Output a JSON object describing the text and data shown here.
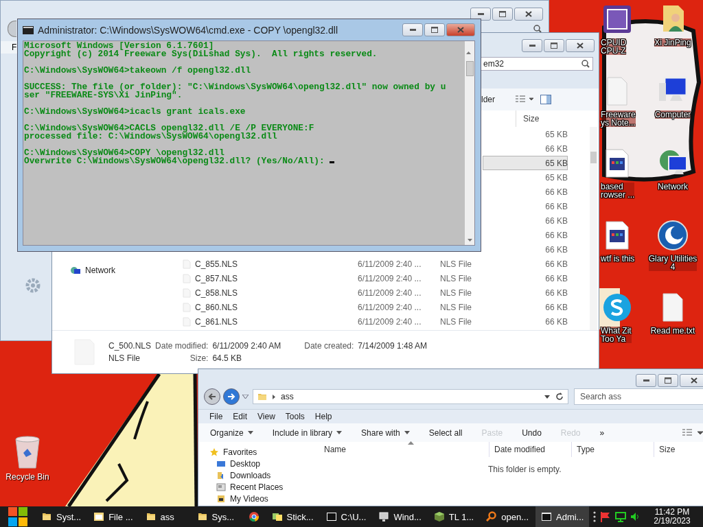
{
  "back_window": {
    "menu": [
      "F"
    ]
  },
  "system32_window": {
    "search_value": "em32",
    "toolbar": [
      "lder"
    ],
    "columns": [
      {
        "label": "Size"
      }
    ],
    "rows": [
      {
        "size": "65 KB",
        "selected": false
      },
      {
        "size": "66 KB",
        "selected": false
      },
      {
        "size": "65 KB",
        "selected": true
      },
      {
        "size": "65 KB",
        "selected": false
      },
      {
        "size": "66 KB",
        "selected": false
      },
      {
        "size": "66 KB",
        "selected": false
      },
      {
        "size": "66 KB",
        "selected": false
      },
      {
        "size": "66 KB",
        "selected": false
      },
      {
        "size": "66 KB",
        "selected": false
      },
      {
        "name": "C_855.NLS",
        "date": "6/11/2009 2:40 ...",
        "type": "NLS File",
        "size": "66 KB",
        "selected": false
      },
      {
        "name": "C_857.NLS",
        "date": "6/11/2009 2:40 ...",
        "type": "NLS File",
        "size": "66 KB",
        "selected": false
      },
      {
        "name": "C_858.NLS",
        "date": "6/11/2009 2:40 ...",
        "type": "NLS File",
        "size": "66 KB",
        "selected": false
      },
      {
        "name": "C_860.NLS",
        "date": "6/11/2009 2:40 ...",
        "type": "NLS File",
        "size": "66 KB",
        "selected": false
      },
      {
        "name": "C_861.NLS",
        "date": "6/11/2009 2:40 ...",
        "type": "NLS File",
        "size": "66 KB",
        "selected": false
      }
    ],
    "nav": [
      {
        "label": "Network"
      }
    ],
    "details": {
      "name": "C_500.NLS",
      "type": "NLS File",
      "date_modified_label": "Date modified:",
      "date_modified": "6/11/2009 2:40 AM",
      "date_created_label": "Date created:",
      "date_created": "7/14/2009 1:48 AM",
      "size_label": "Size:",
      "size": "64.5 KB"
    }
  },
  "cmd_window": {
    "title": "Administrator: C:\\Windows\\SysWOW64\\cmd.exe - COPY  \\opengl32.dll",
    "blocks": [
      [
        "Microsoft Windows [Version 6.1.7601]",
        "Copyright (c) 2014 Freeware Sys(DiLshad Sys).  All rights reserved."
      ],
      [
        "C:\\Windows\\SysWOW64>takeown /f opengl32.dll"
      ],
      [
        "SUCCESS: The file (or folder): \"C:\\Windows\\SysWOW64\\opengl32.dll\" now owned by u",
        "ser \"FREEWARE-SYS\\Xi JinPing\"."
      ],
      [
        "C:\\Windows\\SysWOW64>icacls grant icals.exe"
      ],
      [
        "C:\\Windows\\SysWOW64>CACLS opengl32.dll /E /P EVERYONE:F",
        "processed file: C:\\Windows\\SysWOW64\\opengl32.dll"
      ],
      [
        "C:\\Windows\\SysWOW64>COPY \\opengl32.dll",
        "Overwrite C:\\Windows\\SysWOW64\\opengl32.dll? (Yes/No/All): "
      ]
    ]
  },
  "ass_window": {
    "address": "ass",
    "search_placeholder": "Search ass",
    "menu": [
      "File",
      "Edit",
      "View",
      "Tools",
      "Help"
    ],
    "toolbar": [
      {
        "label": "Organize",
        "kind": "menu",
        "disabled": false
      },
      {
        "label": "Include in library",
        "kind": "menu",
        "disabled": false
      },
      {
        "label": "Share with",
        "kind": "menu",
        "disabled": false
      },
      {
        "label": "Select all",
        "kind": "command",
        "disabled": false
      },
      {
        "label": "Paste",
        "kind": "command",
        "disabled": true
      },
      {
        "label": "Undo",
        "kind": "command",
        "disabled": false
      },
      {
        "label": "Redo",
        "kind": "command",
        "disabled": true
      },
      {
        "label": "»",
        "kind": "more",
        "disabled": false
      }
    ],
    "nav": [
      {
        "label": "Favorites",
        "kind": "star"
      },
      {
        "label": "Desktop",
        "kind": "desktop"
      },
      {
        "label": "Downloads",
        "kind": "downloads"
      },
      {
        "label": "Recent Places",
        "kind": "recent"
      },
      {
        "label": "My Videos",
        "kind": "videos"
      }
    ],
    "columns": [
      {
        "label": "Name"
      },
      {
        "label": "Date modified"
      },
      {
        "label": "Type"
      },
      {
        "label": "Size"
      }
    ],
    "empty_text": "This folder is empty."
  },
  "desktop_icons": [
    {
      "label": "CPUID\nCPU-Z",
      "kind": "chip"
    },
    {
      "label": "Xi JinPing",
      "kind": "user-folder"
    },
    {
      "label": "Freeware\nys Note...",
      "kind": "document"
    },
    {
      "label": "Computer",
      "kind": "computer"
    },
    {
      "label": "based\nrowser ...",
      "kind": "web-page"
    },
    {
      "label": "Network",
      "kind": "network"
    },
    {
      "label": "wtf is this",
      "kind": "web-page"
    },
    {
      "label": "Glary Utilities\n4",
      "kind": "glary"
    },
    {
      "label": "What Zit\nToo Ya",
      "kind": "skype"
    },
    {
      "label": "Read me.txt",
      "kind": "document"
    }
  ],
  "recycle_bin": {
    "label": "Recycle Bin"
  },
  "taskbar": {
    "items": [
      {
        "label": "Syst...",
        "kind": "folder",
        "selected": false
      },
      {
        "label": "File ...",
        "kind": "file-manager",
        "selected": false
      },
      {
        "label": "ass",
        "kind": "folder",
        "selected": false
      },
      {
        "label": "Sys...",
        "kind": "folder",
        "selected": false
      },
      {
        "kind": "browser",
        "selected": false
      },
      {
        "label": "Stick...",
        "kind": "notes",
        "selected": false
      },
      {
        "label": "C:\\U...",
        "kind": "archive",
        "selected": false
      },
      {
        "label": "Wind...",
        "kind": "monitor",
        "selected": false
      },
      {
        "label": "TL 1...",
        "kind": "cube",
        "selected": false
      },
      {
        "label": "open...",
        "kind": "search",
        "selected": false
      },
      {
        "label": "Admi...",
        "kind": "console",
        "selected": true
      }
    ],
    "time": "11:42 PM",
    "date": "2/19/2023"
  }
}
